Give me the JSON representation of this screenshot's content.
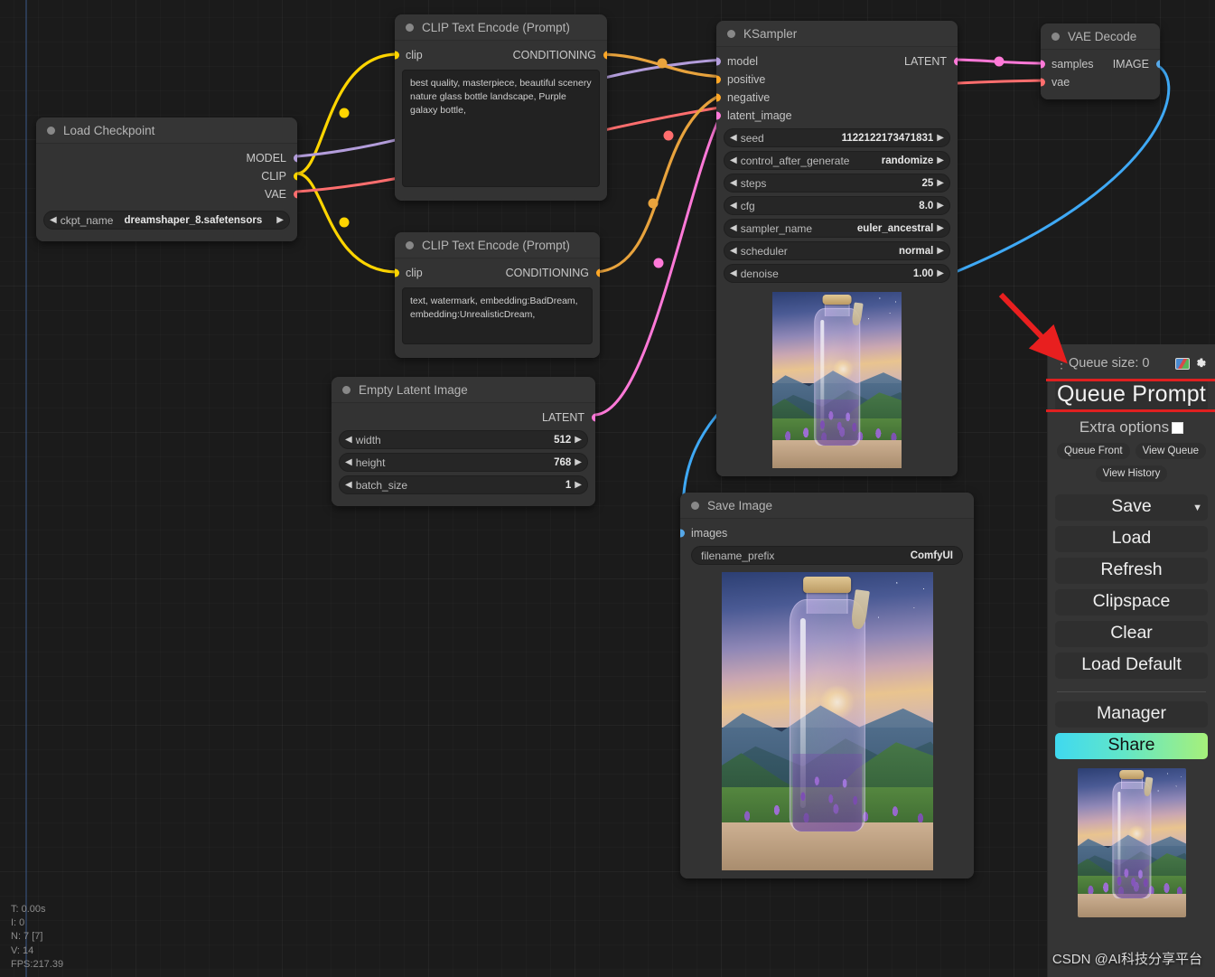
{
  "app": {
    "watermark": "CSDN @AI科技分享平台"
  },
  "stats": {
    "time": "T: 0.00s",
    "iterations": "I: 0",
    "nodes": "N: 7 [7]",
    "vertices": "V: 14",
    "fps": "FPS:217.39"
  },
  "nodes": {
    "load_checkpoint": {
      "title": "Load Checkpoint",
      "outputs": [
        {
          "label": "MODEL",
          "color": "#b39ddb"
        },
        {
          "label": "CLIP",
          "color": "#ffd500"
        },
        {
          "label": "VAE",
          "color": "#ff6e6e"
        }
      ],
      "widgets": [
        {
          "name": "ckpt_name",
          "value": "dreamshaper_8.safetensors"
        }
      ]
    },
    "clip_positive": {
      "title": "CLIP Text Encode (Prompt)",
      "input": {
        "label": "clip",
        "color": "#ffd500"
      },
      "output": {
        "label": "CONDITIONING",
        "color": "#ffa726"
      },
      "text": "best quality, masterpiece, beautiful scenery nature glass bottle landscape, Purple galaxy bottle,"
    },
    "clip_negative": {
      "title": "CLIP Text Encode (Prompt)",
      "input": {
        "label": "clip",
        "color": "#ffd500"
      },
      "output": {
        "label": "CONDITIONING",
        "color": "#ffa726"
      },
      "text": "text, watermark, embedding:BadDream, embedding:UnrealisticDream,"
    },
    "empty_latent": {
      "title": "Empty Latent Image",
      "output": {
        "label": "LATENT",
        "color": "#ff79d8"
      },
      "widgets": [
        {
          "name": "width",
          "value": "512"
        },
        {
          "name": "height",
          "value": "768"
        },
        {
          "name": "batch_size",
          "value": "1"
        }
      ]
    },
    "ksampler": {
      "title": "KSampler",
      "inputs": [
        {
          "label": "model",
          "color": "#b39ddb"
        },
        {
          "label": "positive",
          "color": "#ffa726"
        },
        {
          "label": "negative",
          "color": "#ffa726"
        },
        {
          "label": "latent_image",
          "color": "#ff79d8"
        }
      ],
      "output": {
        "label": "LATENT",
        "color": "#ff79d8"
      },
      "widgets": [
        {
          "name": "seed",
          "value": "1122122173471831"
        },
        {
          "name": "control_after_generate",
          "value": "randomize"
        },
        {
          "name": "steps",
          "value": "25"
        },
        {
          "name": "cfg",
          "value": "8.0"
        },
        {
          "name": "sampler_name",
          "value": "euler_ancestral"
        },
        {
          "name": "scheduler",
          "value": "normal"
        },
        {
          "name": "denoise",
          "value": "1.00"
        }
      ]
    },
    "vae_decode": {
      "title": "VAE Decode",
      "inputs": [
        {
          "label": "samples",
          "color": "#ff79d8"
        },
        {
          "label": "vae",
          "color": "#ff6e6e"
        }
      ],
      "output": {
        "label": "IMAGE",
        "color": "#56a8e8"
      }
    },
    "save_image": {
      "title": "Save Image",
      "input": {
        "label": "images",
        "color": "#56a8e8"
      },
      "widgets": [
        {
          "name": "filename_prefix",
          "value": "ComfyUI"
        }
      ]
    }
  },
  "panel": {
    "queue_size": "Queue size: 0",
    "queue_prompt": "Queue Prompt",
    "extra_options": "Extra options",
    "queue_front": "Queue Front",
    "view_queue": "View Queue",
    "view_history": "View History",
    "save": "Save",
    "load": "Load",
    "refresh": "Refresh",
    "clipspace": "Clipspace",
    "clear": "Clear",
    "load_default": "Load Default",
    "manager": "Manager",
    "share": "Share",
    "share_color": "#3fd9f0"
  },
  "link_colors": {
    "model": "#b39ddb",
    "clip": "#ffd500",
    "vae": "#ff6e6e",
    "conditioning": "#e8a33d",
    "latent": "#ff79d8",
    "image": "#3fa9f5"
  },
  "annotation": {
    "arrow_color": "#e81f1f",
    "highlight_color": "#e02020"
  }
}
